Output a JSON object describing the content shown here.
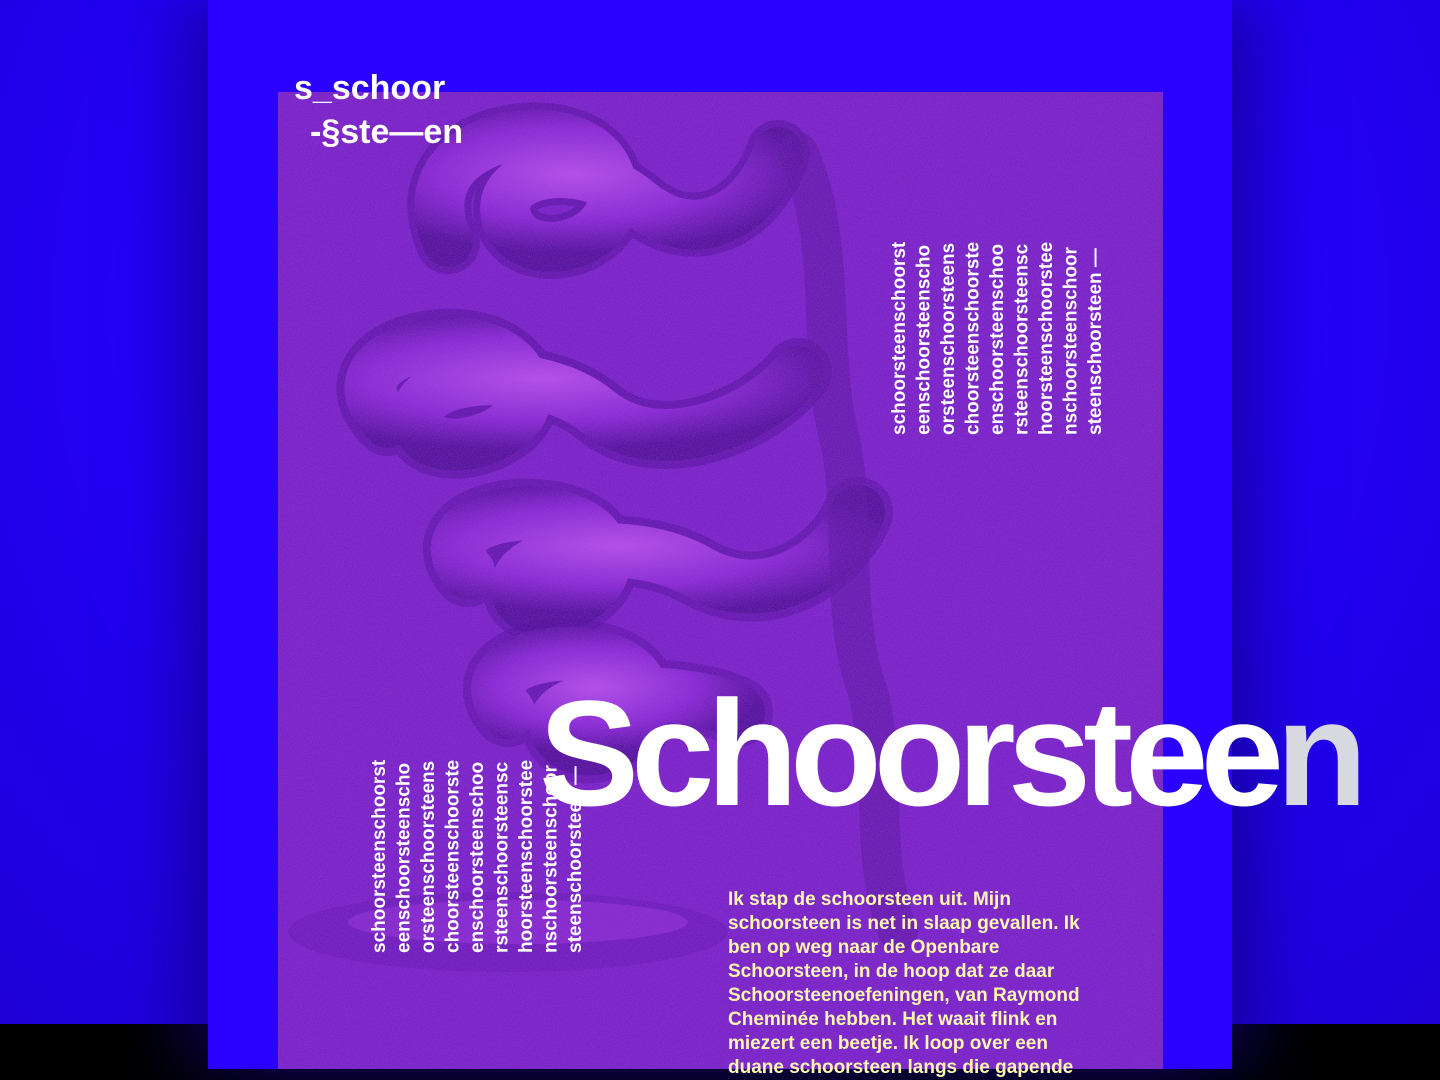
{
  "title": {
    "line1": "s_schoor",
    "line2": "-§ste—en"
  },
  "vertical_top": [
    "schoorsteenschoorst",
    "eenschoorsteenscho",
    "orsteenschoorsteens",
    "choorsteenschoorste",
    "enschoorsteenschoo",
    "rsteenschoorsteensc",
    "hoorsteenschoorstee",
    "nschoorsteenschoor",
    "steenschoorsteen —"
  ],
  "vertical_bottom": [
    "schoorsteenschoorst",
    "eenschoorsteenscho",
    "orsteenschoorsteens",
    "choorsteenschoorste",
    "enschoorsteenschoo",
    "rsteenschoorsteensc",
    "hoorsteenschoorstee",
    "nschoorsteenschoor",
    "steenschoorsteen —"
  ],
  "headline": {
    "main": "Schoorstee",
    "tail": "n"
  },
  "body": "Ik stap de schoorsteen uit. Mijn schoorsteen is net in slaap gevallen. Ik ben op weg naar de Openbare Schoorsteen, in de hoop dat ze daar Schoorsteenoefeningen, van Raymond Cheminée hebben. Het waait flink en miezert een beetje. Ik loop over een duane schoorsteen langs die gapende",
  "colors": {
    "background": "#2400ff",
    "poster": "#2a00ff",
    "text": "#ffffff",
    "body_text": "#fff6b0"
  }
}
